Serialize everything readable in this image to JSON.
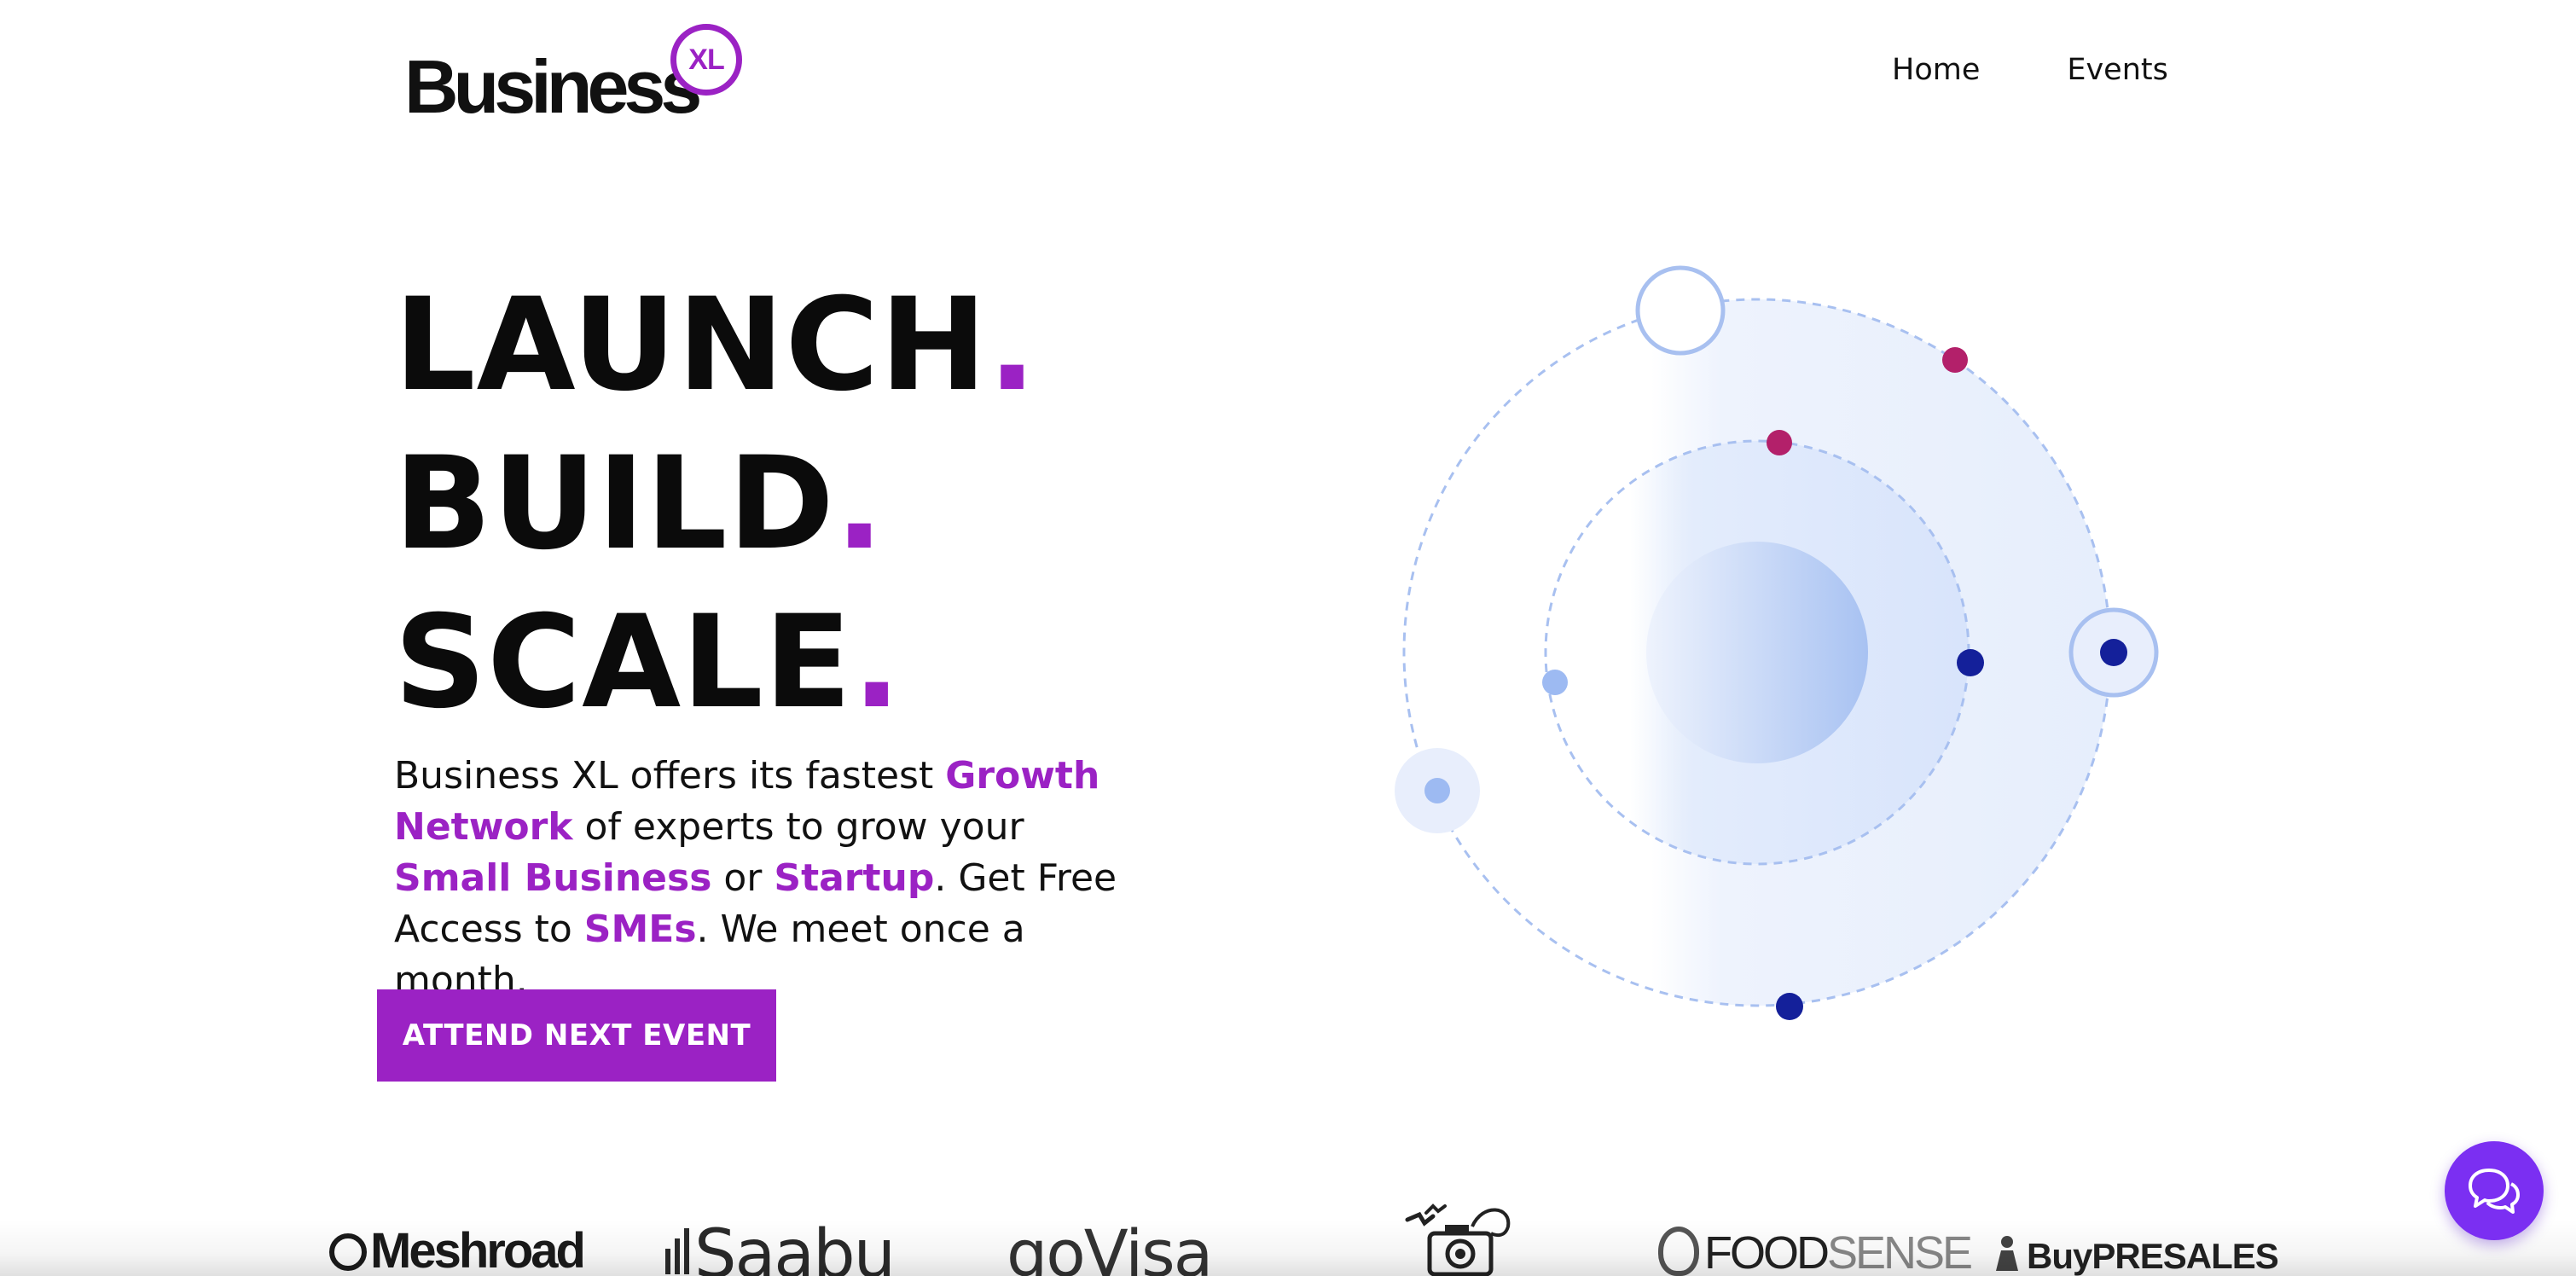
{
  "header": {
    "logo": {
      "word": "Business",
      "badge": "XL",
      "badge_color": "#9b22c4"
    },
    "nav": [
      {
        "label": "Home"
      },
      {
        "label": "Events"
      }
    ]
  },
  "hero": {
    "headline": [
      {
        "word": "LAUNCH",
        "dot": "."
      },
      {
        "word": "BUILD",
        "dot": "."
      },
      {
        "word": "SCALE",
        "dot": "."
      }
    ],
    "description": {
      "t1": "Business XL offers its fastest ",
      "h1": "Growth Network",
      "t2": " of experts to grow your ",
      "h2": "Small Business",
      "t3": " or ",
      "h3": "Startup",
      "t4": ". Get Free Access to ",
      "h4": "SMEs",
      "t5": ". We meet once a month."
    },
    "cta_label": "ATTEND NEXT EVENT"
  },
  "partners": {
    "meshroad": "Meshroad",
    "saabu": "Saabu",
    "govisa": {
      "a": "go",
      "b": "Visa"
    },
    "foodsense": {
      "a": "FOOD",
      "b": "SENSE"
    },
    "buypresales": {
      "a": "Buy",
      "b": "PRESALES"
    }
  },
  "colors": {
    "accent": "#9b22c4",
    "orbit_light": "#9dbaf2",
    "dot_navy": "#14209a",
    "dot_magenta": "#b3206a",
    "chat": "#7b2ff2"
  },
  "icons": {
    "chat": "chat-bubbles-icon",
    "camera": "camera-birds-icon"
  }
}
